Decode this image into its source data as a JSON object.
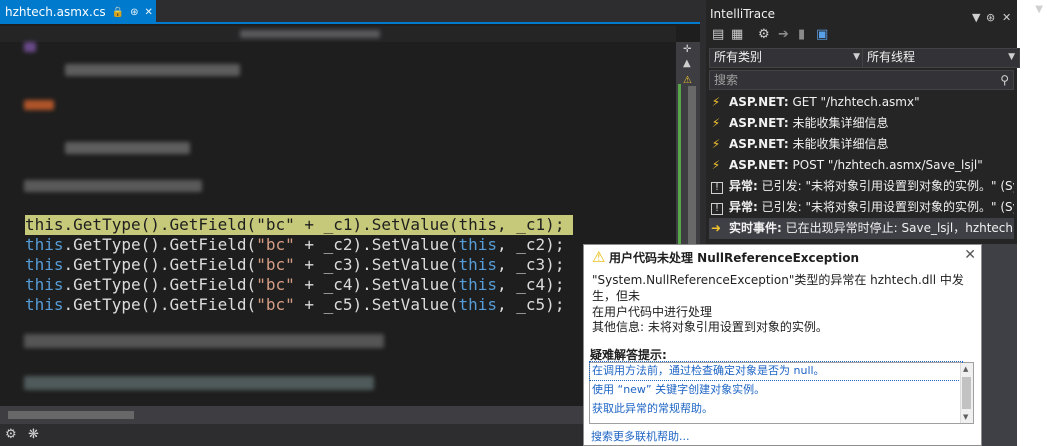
{
  "editor": {
    "tab": {
      "name": "hzhtech.asmx.cs",
      "lock_icon": "lock-icon",
      "pin_icon": "pin-icon",
      "close_icon": "close-icon"
    },
    "code_lines": [
      [
        [
          "kw",
          "this"
        ],
        [
          "id",
          ".GetType().GetField("
        ],
        [
          "str",
          "\"bc\""
        ],
        [
          "id",
          " + _c1).SetValue("
        ],
        [
          "kw",
          "this"
        ],
        [
          "id",
          ", _c1);"
        ]
      ],
      [
        [
          "kw",
          "this"
        ],
        [
          "id",
          ".GetType().GetField("
        ],
        [
          "str",
          "\"bc\""
        ],
        [
          "id",
          " + _c2).SetValue("
        ],
        [
          "kw",
          "this"
        ],
        [
          "id",
          ", _c2);"
        ]
      ],
      [
        [
          "kw",
          "this"
        ],
        [
          "id",
          ".GetType().GetField("
        ],
        [
          "str",
          "\"bc\""
        ],
        [
          "id",
          " + _c3).SetValue("
        ],
        [
          "kw",
          "this"
        ],
        [
          "id",
          ", _c3);"
        ]
      ],
      [
        [
          "kw",
          "this"
        ],
        [
          "id",
          ".GetType().GetField("
        ],
        [
          "str",
          "\"bc\""
        ],
        [
          "id",
          " + _c4).SetValue("
        ],
        [
          "kw",
          "this"
        ],
        [
          "id",
          ", _c4);"
        ]
      ],
      [
        [
          "kw",
          "this"
        ],
        [
          "id",
          ".GetType().GetField("
        ],
        [
          "str",
          "\"bc\""
        ],
        [
          "id",
          " + _c5).SetValue("
        ],
        [
          "kw",
          "this"
        ],
        [
          "id",
          ", _c5);"
        ]
      ]
    ]
  },
  "intellitrace": {
    "title": "IntelliTrace",
    "category_filter": "所有类别",
    "thread_filter": "所有线程",
    "search_placeholder": "搜索",
    "events": [
      {
        "icon": "bolt-icon",
        "category": "ASP.NET:",
        "text": "GET \"/hzhtech.asmx\""
      },
      {
        "icon": "bolt-icon",
        "category": "ASP.NET:",
        "text": "未能收集详细信息"
      },
      {
        "icon": "bolt-icon",
        "category": "ASP.NET:",
        "text": "未能收集详细信息"
      },
      {
        "icon": "bolt-icon",
        "category": "ASP.NET:",
        "text": "POST \"/hzhtech.asmx/Save_lsjl\""
      },
      {
        "icon": "exception-icon",
        "category": "异常:",
        "text": "已引发: \"未将对象引用设置到对象的实例。\" (Sy"
      },
      {
        "icon": "exception-icon",
        "category": "异常:",
        "text": "已引发: \"未将对象引用设置到对象的实例。\" (Sy"
      },
      {
        "icon": "live-event-icon",
        "category": "实时事件:",
        "text": "已在出现异常时停止: Save_lsjl，hzhtech.a"
      }
    ]
  },
  "exception_popup": {
    "title": "用户代码未处理 NullReferenceException",
    "message_line1": "\"System.NullReferenceException\"类型的异常在 hzhtech.dll 中发生，但未",
    "message_line2": "在用户代码中进行处理",
    "additional_info": "其他信息: 未将对象引用设置到对象的实例。",
    "tips_header": "疑难解答提示:",
    "tips": [
      "在调用方法前，通过检查确定对象是否为 null。",
      "使用 “new” 关键字创建对象实例。",
      "获取此异常的常规帮助。"
    ],
    "more_help_link": "搜索更多联机帮助..."
  },
  "colors": {
    "editor_bg": "#1e1e1e",
    "accent": "#007acc",
    "keyword": "#569cd6",
    "string": "#d69d85",
    "link": "#1d64c4",
    "warning": "#e8b800"
  }
}
